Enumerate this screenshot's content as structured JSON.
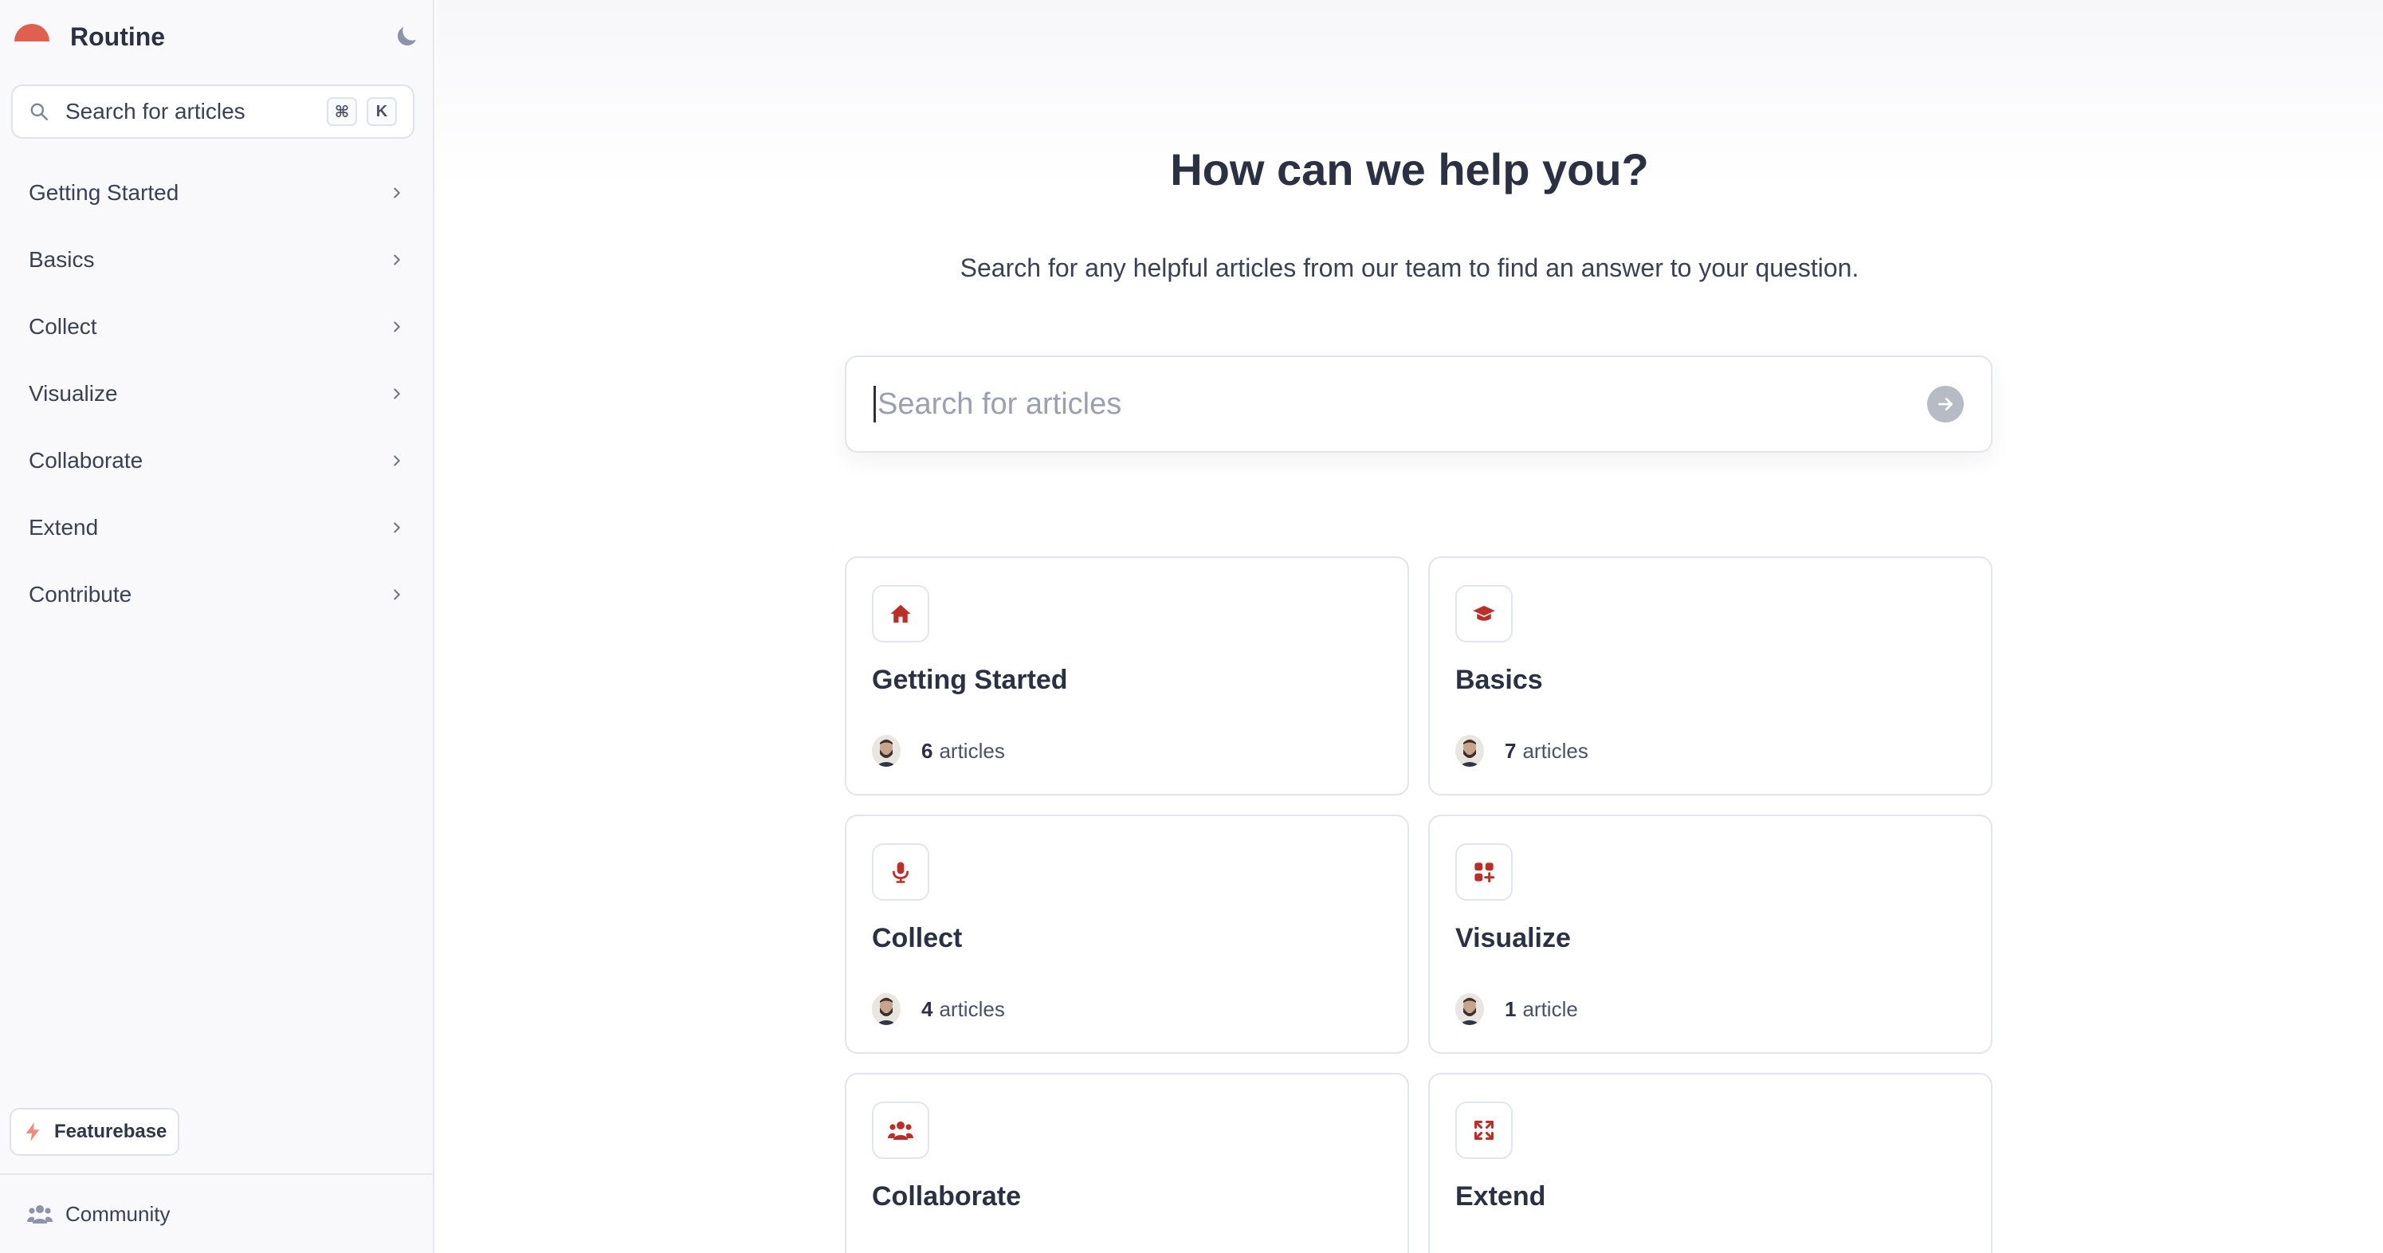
{
  "brand": {
    "name": "Routine",
    "logo_color": "#e0604f"
  },
  "sidebar": {
    "search_label": "Search for articles",
    "shortcut_keys": [
      "⌘",
      "K"
    ],
    "items": [
      {
        "label": "Getting Started"
      },
      {
        "label": "Basics"
      },
      {
        "label": "Collect"
      },
      {
        "label": "Visualize"
      },
      {
        "label": "Collaborate"
      },
      {
        "label": "Extend"
      },
      {
        "label": "Contribute"
      }
    ],
    "featurebase_label": "Featurebase",
    "community_label": "Community"
  },
  "main": {
    "title": "How can we help you?",
    "subtitle": "Search for any helpful articles from our team to find an answer to your question.",
    "search_placeholder": "Search for articles",
    "search_value": "",
    "cards": [
      {
        "title": "Getting Started",
        "count": "6",
        "unit": "articles",
        "icon": "home-icon"
      },
      {
        "title": "Basics",
        "count": "7",
        "unit": "articles",
        "icon": "graduation-cap-icon"
      },
      {
        "title": "Collect",
        "count": "4",
        "unit": "articles",
        "icon": "microphone-icon"
      },
      {
        "title": "Visualize",
        "count": "1",
        "unit": "article",
        "icon": "apps-icon"
      },
      {
        "title": "Collaborate",
        "count": "",
        "unit": "",
        "icon": "users-icon"
      },
      {
        "title": "Extend",
        "count": "",
        "unit": "",
        "icon": "expand-icon"
      }
    ]
  },
  "colors": {
    "accent": "#b9302a",
    "text": "#2b3142",
    "sidebar_bg": "#f9f9fb"
  }
}
